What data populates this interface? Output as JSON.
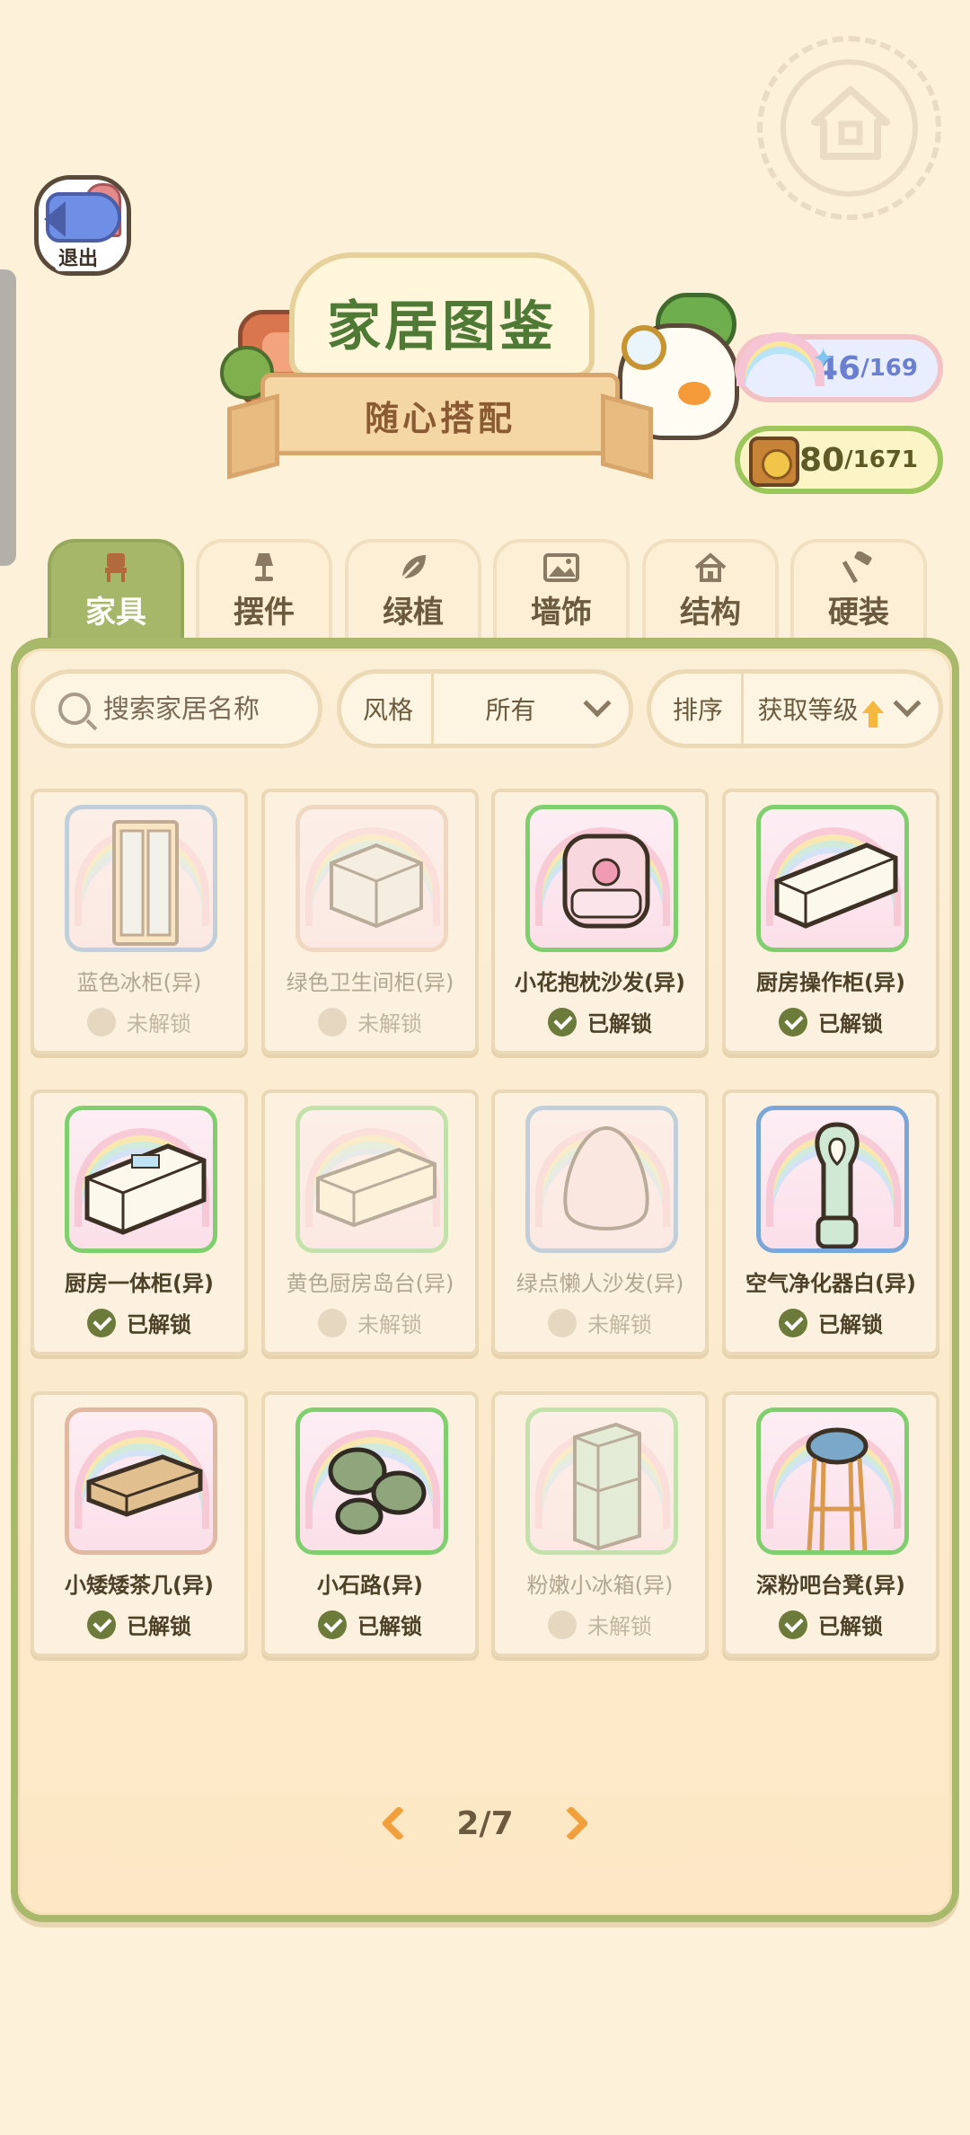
{
  "header": {
    "exit_label": "退出",
    "title": "家居图鉴",
    "subtitle": "随心搭配"
  },
  "counters": {
    "collection": {
      "current": "46",
      "total": "/169",
      "icon": "rainbow-icon"
    },
    "score": {
      "current": "580",
      "total": "/1671",
      "icon": "medal-icon"
    }
  },
  "tabs": [
    {
      "label": "家具",
      "icon": "chair-icon",
      "active": true
    },
    {
      "label": "摆件",
      "icon": "lamp-icon",
      "active": false
    },
    {
      "label": "绿植",
      "icon": "leaf-icon",
      "active": false
    },
    {
      "label": "墙饰",
      "icon": "picture-icon",
      "active": false
    },
    {
      "label": "结构",
      "icon": "house-icon",
      "active": false
    },
    {
      "label": "硬装",
      "icon": "hammer-icon",
      "active": false
    }
  ],
  "filters": {
    "search_placeholder": "搜索家居名称",
    "style_label": "风格",
    "style_value": "所有",
    "sort_label": "排序",
    "sort_value": "获取等级"
  },
  "items": [
    {
      "name": "蓝色冰柜(异)",
      "status": "未解锁",
      "unlocked": false
    },
    {
      "name": "绿色卫生间柜(异)",
      "status": "未解锁",
      "unlocked": false
    },
    {
      "name": "小花抱枕沙发(异)",
      "status": "已解锁",
      "unlocked": true
    },
    {
      "name": "厨房操作柜(异)",
      "status": "已解锁",
      "unlocked": true
    },
    {
      "name": "厨房一体柜(异)",
      "status": "已解锁",
      "unlocked": true
    },
    {
      "name": "黄色厨房岛台(异)",
      "status": "未解锁",
      "unlocked": false
    },
    {
      "name": "绿点懒人沙发(异)",
      "status": "未解锁",
      "unlocked": false
    },
    {
      "name": "空气净化器白(异)",
      "status": "已解锁",
      "unlocked": true
    },
    {
      "name": "小矮矮茶几(异)",
      "status": "已解锁",
      "unlocked": true
    },
    {
      "name": "小石路(异)",
      "status": "已解锁",
      "unlocked": true
    },
    {
      "name": "粉嫩小冰箱(异)",
      "status": "未解锁",
      "unlocked": false
    },
    {
      "name": "深粉吧台凳(异)",
      "status": "已解锁",
      "unlocked": true
    }
  ],
  "pagination": {
    "current": "2/7"
  },
  "colors": {
    "accent_green": "#a6b76a",
    "title_green": "#4e7a35",
    "pager_orange": "#f2a03c"
  }
}
